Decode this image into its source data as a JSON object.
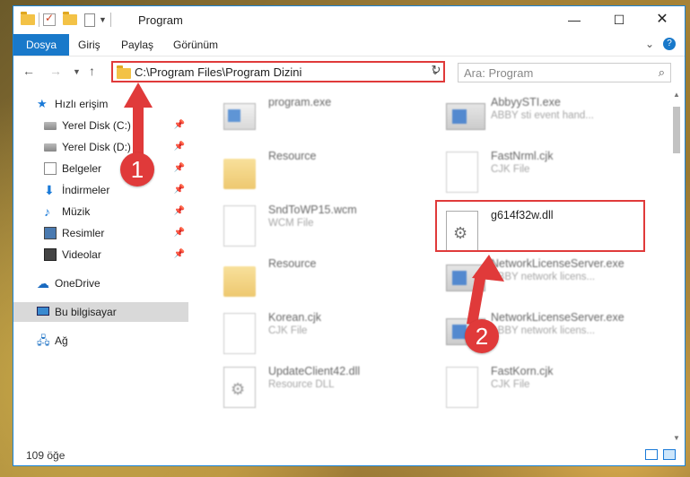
{
  "window": {
    "title": "Program"
  },
  "ribbon": {
    "tabs": [
      "Dosya",
      "Giriş",
      "Paylaş",
      "Görünüm"
    ]
  },
  "address": {
    "path": "C:\\Program Files\\Program Dizini",
    "search_placeholder": "Ara: Program"
  },
  "navpane": {
    "items": [
      {
        "label": "Hızlı erişim",
        "icon": "star-icon"
      },
      {
        "label": "Yerel Disk (C:)",
        "icon": "drive-icon",
        "pinned": true
      },
      {
        "label": "Yerel Disk (D:)",
        "icon": "drive-icon",
        "pinned": true
      },
      {
        "label": "Belgeler",
        "icon": "documents-icon",
        "pinned": true
      },
      {
        "label": "İndirmeler",
        "icon": "downloads-icon",
        "pinned": true
      },
      {
        "label": "Müzik",
        "icon": "music-icon",
        "pinned": true
      },
      {
        "label": "Resimler",
        "icon": "pictures-icon",
        "pinned": true
      },
      {
        "label": "Videolar",
        "icon": "videos-icon",
        "pinned": true
      },
      {
        "label": "OneDrive",
        "icon": "onedrive-icon"
      },
      {
        "label": "Bu bilgisayar",
        "icon": "computer-icon",
        "selected": true
      },
      {
        "label": "Ağ",
        "icon": "network-icon"
      }
    ]
  },
  "files": [
    {
      "name": "program.exe",
      "type": ""
    },
    {
      "name": "AbbyySTI.exe",
      "type": "ABBY sti event hand..."
    },
    {
      "name": "Resource",
      "type": ""
    },
    {
      "name": "FastNrml.cjk",
      "type": "CJK File"
    },
    {
      "name": "SndToWP15.wcm",
      "type": "WCM File"
    },
    {
      "name": "g614f32w.dll",
      "type": ""
    },
    {
      "name": "Resource",
      "type": ""
    },
    {
      "name": "NetworkLicenseServer.exe",
      "type": "ABBY network licens..."
    },
    {
      "name": "Korean.cjk",
      "type": "CJK File"
    },
    {
      "name": "NetworkLicenseServer.exe",
      "type": "ABBY network licens..."
    },
    {
      "name": "UpdateClient42.dll",
      "type": "Resource DLL"
    },
    {
      "name": "FastKorn.cjk",
      "type": "CJK File"
    }
  ],
  "annotations": {
    "step1": "1",
    "step2": "2",
    "color": "#e03a3a"
  },
  "status": {
    "count": "109 öğe"
  }
}
